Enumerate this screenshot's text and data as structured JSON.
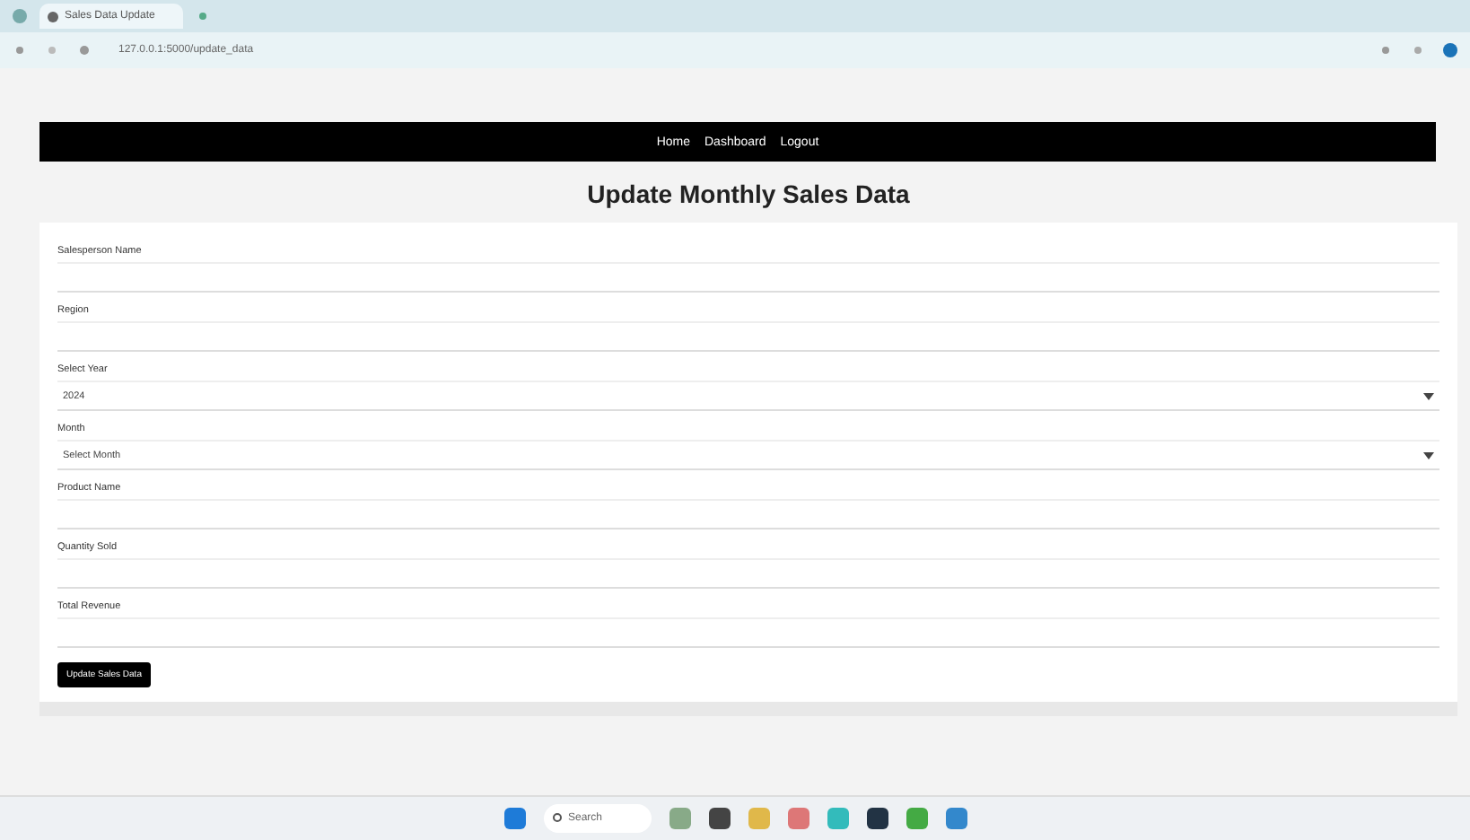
{
  "browser": {
    "tab_title": "Sales Data Update",
    "url": "127.0.0.1:5000/update_data"
  },
  "nav": {
    "links": [
      "Home",
      "Dashboard",
      "Logout"
    ]
  },
  "page_title": "Update Monthly Sales Data",
  "form": {
    "fields": [
      {
        "kind": "text",
        "label": "Salesperson Name"
      },
      {
        "kind": "text",
        "label": "Region"
      },
      {
        "kind": "select",
        "label": "Select Year",
        "value": "2024"
      },
      {
        "kind": "select",
        "label": "Month",
        "value": "Select Month"
      },
      {
        "kind": "text",
        "label": "Product Name"
      },
      {
        "kind": "text",
        "label": "Quantity Sold"
      },
      {
        "kind": "text",
        "label": "Total Revenue"
      }
    ],
    "submit": "Update Sales Data"
  },
  "taskbar": {
    "search_placeholder": "Search"
  }
}
